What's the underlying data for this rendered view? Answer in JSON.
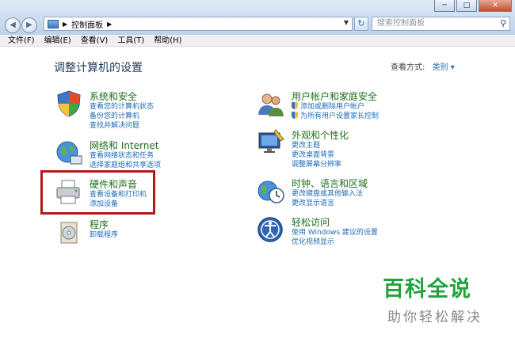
{
  "address": {
    "path": "控制面板",
    "search_placeholder": "搜索控制面板"
  },
  "menu": [
    "文件(F)",
    "编辑(E)",
    "查看(V)",
    "工具(T)",
    "帮助(H)"
  ],
  "heading": "调整计算机的设置",
  "view_by": {
    "label": "查看方式:",
    "value": "类别 ▾"
  },
  "categories_left": [
    {
      "title": "系统和安全",
      "links": [
        "查看您的计算机状态",
        "备份您的计算机",
        "查找并解决问题"
      ]
    },
    {
      "title": "网络和 Internet",
      "links": [
        "查看网络状态和任务",
        "选择家庭组和共享选项"
      ]
    },
    {
      "title": "硬件和声音",
      "links": [
        "查看设备和打印机",
        "添加设备"
      ]
    },
    {
      "title": "程序",
      "links": [
        "卸载程序"
      ]
    }
  ],
  "categories_right": [
    {
      "title": "用户帐户和家庭安全",
      "links": [
        "添加或删除用户帐户",
        "为所有用户设置家长控制"
      ]
    },
    {
      "title": "外观和个性化",
      "links": [
        "更改主题",
        "更改桌面背景",
        "调整屏幕分辨率"
      ]
    },
    {
      "title": "时钟、语言和区域",
      "links": [
        "更改键盘或其他输入法",
        "更改显示语言"
      ]
    },
    {
      "title": "轻松访问",
      "links": [
        "使用 Windows 建议的设置",
        "优化视频显示"
      ]
    }
  ],
  "watermark": {
    "line1": "百科全说",
    "line2": "助你轻松解决"
  }
}
